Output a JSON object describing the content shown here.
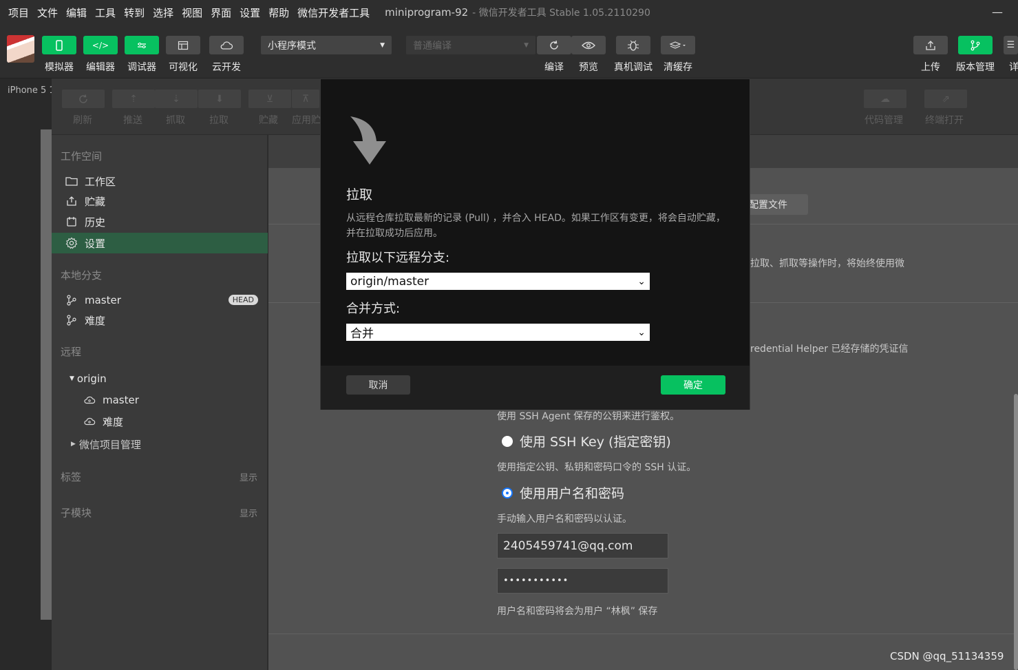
{
  "menu": {
    "items": [
      "项目",
      "文件",
      "编辑",
      "工具",
      "转到",
      "选择",
      "视图",
      "界面",
      "设置",
      "帮助",
      "微信开发者工具"
    ],
    "window_title": "miniprogram-92",
    "window_subtitle": "- 微信开发者工具 Stable 1.05.2110290",
    "minimize": "—"
  },
  "toolbar": {
    "simulator": "模拟器",
    "editor": "编辑器",
    "debugger": "调试器",
    "visual": "可视化",
    "cloud": "云开发",
    "mode": "小程序模式",
    "compile_mode": "普通编译",
    "compile": "编译",
    "preview": "预览",
    "device_debug": "真机调试",
    "clear_cache": "清缓存",
    "upload": "上传",
    "version": "版本管理",
    "details": "详"
  },
  "device": {
    "label": "iPhone 5 1"
  },
  "version_toolbar": {
    "refresh": "刷新",
    "push": "推送",
    "fetch": "抓取",
    "pull": "拉取",
    "stash": "贮藏",
    "apply": "应用贮",
    "code_mgmt": "代码管理",
    "terminal": "终端打开"
  },
  "sidebar": {
    "workspace_title": "工作空间",
    "workspace_items": [
      "工作区",
      "贮藏",
      "历史",
      "设置"
    ],
    "local_branch_title": "本地分支",
    "branches": [
      "master",
      "难度"
    ],
    "head_badge": "HEAD",
    "remote_title": "远程",
    "remote_origin": "origin",
    "remote_branches": [
      "master",
      "难度"
    ],
    "remote_other": "微信项目管理",
    "tags_title": "标签",
    "submodules_title": "子模块",
    "show": "显示"
  },
  "settings": {
    "config_button": "配置文件",
    "text1": "拉取、抓取等操作时，将始终使用微",
    "text2": "redential Helper 已经存储的凭证信",
    "ssh_agent_desc": "使用 SSH Agent 保存的公钥来进行鉴权。",
    "ssh_key_label": "使用 SSH Key (指定密钥)",
    "ssh_key_desc": "使用指定公钥、私钥和密码口令的 SSH 认证。",
    "userpass_label": "使用用户名和密码",
    "userpass_desc": "手动输入用户名和密码以认证。",
    "username": "2405459741@qq.com",
    "password": "•••••••••••",
    "save_note": "用户名和密码将会为用户 “林枫” 保存"
  },
  "modal": {
    "title": "拉取",
    "description": "从远程仓库拉取最新的记录 (Pull) ，并合入 HEAD。如果工作区有变更，将会自动贮藏，并在拉取成功后应用。",
    "branch_label": "拉取以下远程分支:",
    "branch_value": "origin/master",
    "merge_label": "合并方式:",
    "merge_value": "合并",
    "cancel": "取消",
    "ok": "确定"
  },
  "watermark": "CSDN @qq_51134359",
  "colors": {
    "accent": "#07c160",
    "active_row": "#2d5e43",
    "radio": "#1677ff"
  }
}
